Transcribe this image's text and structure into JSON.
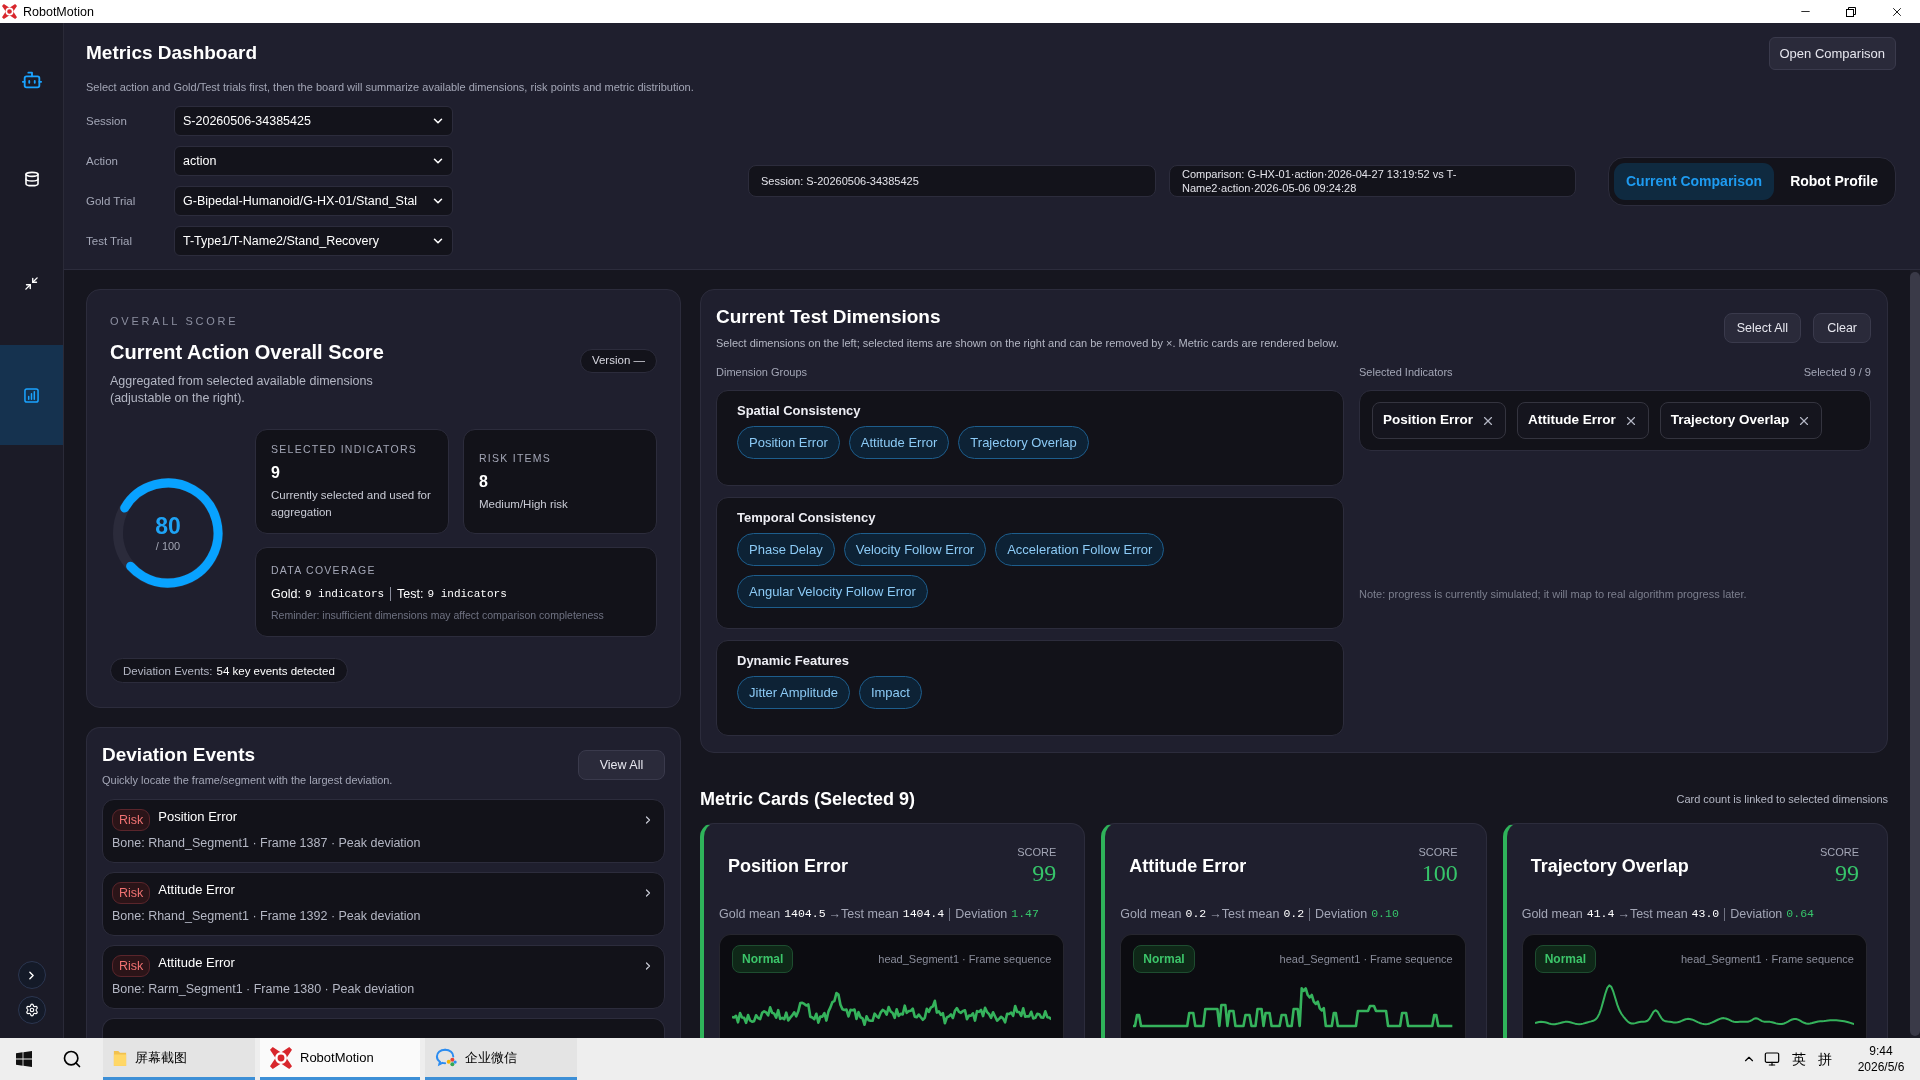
{
  "window": {
    "title": "RobotMotion"
  },
  "sidebar": {
    "items": [
      {
        "selected": false
      },
      {
        "selected": false
      },
      {
        "selected": true
      }
    ]
  },
  "header": {
    "title": "Metrics Dashboard",
    "subtitle": "Select action and Gold/Test trials first, then the board will summarize available dimensions, risk points and metric distribution.",
    "open_button": "Open Comparison",
    "fields": [
      {
        "label": "Session",
        "value": "S-20260506-34385425"
      },
      {
        "label": "Action",
        "value": "action"
      },
      {
        "label": "Gold Trial",
        "value": "G-Bipedal-Humanoid/G-HX-01/Stand_Stal"
      },
      {
        "label": "Test Trial",
        "value": "T-Type1/T-Name2/Stand_Recovery"
      }
    ],
    "info": [
      "Session: S-20260506-34385425",
      "Comparison: G-HX-01·action·2026-04-27 13:19:52 vs T-Name2·action·2026-05-06 09:24:28"
    ],
    "view_tabs": [
      {
        "label": "Current Comparison",
        "selected": true
      },
      {
        "label": "Robot Profile",
        "selected": false
      }
    ]
  },
  "overall": {
    "eyebrow": "OVERALL SCORE",
    "title": "Current Action Overall Score",
    "version_button": "Version —",
    "description": "Aggregated from selected available dimensions (adjustable on the right).",
    "gauge": {
      "score": "80",
      "max": "/ 100",
      "level": 0.8
    },
    "stats": [
      {
        "label": "SELECTED INDICATORS",
        "value": "9",
        "description": "Currently selected and used for aggregation"
      },
      {
        "label": "RISK ITEMS",
        "value": "8",
        "description": "Medium/High risk"
      }
    ],
    "coverage": {
      "label": "DATA COVERAGE",
      "gold_label": "Gold:",
      "gold_value": "9 indicators",
      "test_label": "Test:",
      "test_value": "9 indicators",
      "reminder": "Reminder: insufficient dimensions may affect comparison completeness"
    },
    "events_pill": {
      "label": "Deviation Events:",
      "value": "54 key events detected"
    }
  },
  "deviation_events": {
    "title": "Deviation Events",
    "subtitle": "Quickly locate the frame/segment with the largest deviation.",
    "view_all": "View All",
    "items": [
      {
        "badge": "Risk",
        "title": "Position Error",
        "detail": "Bone: Rhand_Segment1 · Frame 1387 · Peak deviation"
      },
      {
        "badge": "Risk",
        "title": "Attitude Error",
        "detail": "Bone: Rhand_Segment1 · Frame 1392 · Peak deviation"
      },
      {
        "badge": "Risk",
        "title": "Attitude Error",
        "detail": "Bone: Rarm_Segment1 · Frame 1380 · Peak deviation"
      }
    ]
  },
  "dimensions": {
    "title": "Current Test Dimensions",
    "subtitle": "Select dimensions on the left; selected items are shown on the right and can be removed by ×. Metric cards are rendered below.",
    "select_all": "Select All",
    "clear": "Clear",
    "groups_label": "Dimension Groups",
    "groups": [
      {
        "title": "Spatial Consistency",
        "items": [
          {
            "label": "Position Error",
            "selected": true
          },
          {
            "label": "Attitude Error",
            "selected": true
          },
          {
            "label": "Trajectory Overlap",
            "selected": true
          }
        ]
      },
      {
        "title": "Temporal Consistency",
        "items": [
          {
            "label": "Phase Delay",
            "selected": true
          },
          {
            "label": "Velocity Follow Error",
            "selected": true
          },
          {
            "label": "Acceleration Follow Error",
            "selected": true
          },
          {
            "label": "Angular Velocity Follow Error",
            "selected": true
          }
        ]
      },
      {
        "title": "Dynamic Features",
        "items": [
          {
            "label": "Jitter Amplitude",
            "selected": true
          },
          {
            "label": "Impact",
            "selected": true
          }
        ]
      }
    ],
    "selected_label": "Selected Indicators",
    "selected_count": "Selected 9 / 9",
    "selected_items": [
      "Position Error",
      "Attitude Error",
      "Trajectory Overlap"
    ],
    "note": "Note: progress is currently simulated; it will map to real algorithm progress later."
  },
  "metric_cards": {
    "title": "Metric Cards (Selected 9)",
    "hint": "Card count is linked to selected dimensions",
    "cards": [
      {
        "title": "Position Error",
        "score_label": "SCORE",
        "score": "99",
        "stats": [
          {
            "label": "Gold mean",
            "value": "1404.5"
          },
          {
            "label": "→Test mean",
            "value": "1404.4"
          },
          {
            "label": "Deviation",
            "value": "1.47"
          }
        ],
        "status": "Normal",
        "caption": "head_Segment1 · Frame sequence"
      },
      {
        "title": "Attitude Error",
        "score_label": "SCORE",
        "score": "100",
        "stats": [
          {
            "label": "Gold mean",
            "value": "0.2"
          },
          {
            "label": "→Test mean",
            "value": "0.2"
          },
          {
            "label": "Deviation",
            "value": "0.10"
          }
        ],
        "status": "Normal",
        "caption": "head_Segment1 · Frame sequence"
      },
      {
        "title": "Trajectory Overlap",
        "score_label": "SCORE",
        "score": "99",
        "stats": [
          {
            "label": "Gold mean",
            "value": "41.4"
          },
          {
            "label": "→Test mean",
            "value": "43.0"
          },
          {
            "label": "Deviation",
            "value": "0.64"
          }
        ],
        "status": "Normal",
        "caption": "head_Segment1 · Frame sequence"
      }
    ]
  },
  "taskbar": {
    "apps": [
      {
        "label": "屏幕截图",
        "selected": false
      },
      {
        "label": "RobotMotion",
        "selected": true
      },
      {
        "label": "企业微信",
        "selected": false
      }
    ],
    "tray": [
      "英",
      "拼"
    ],
    "time": "9:44",
    "date": "2026/5/6"
  }
}
